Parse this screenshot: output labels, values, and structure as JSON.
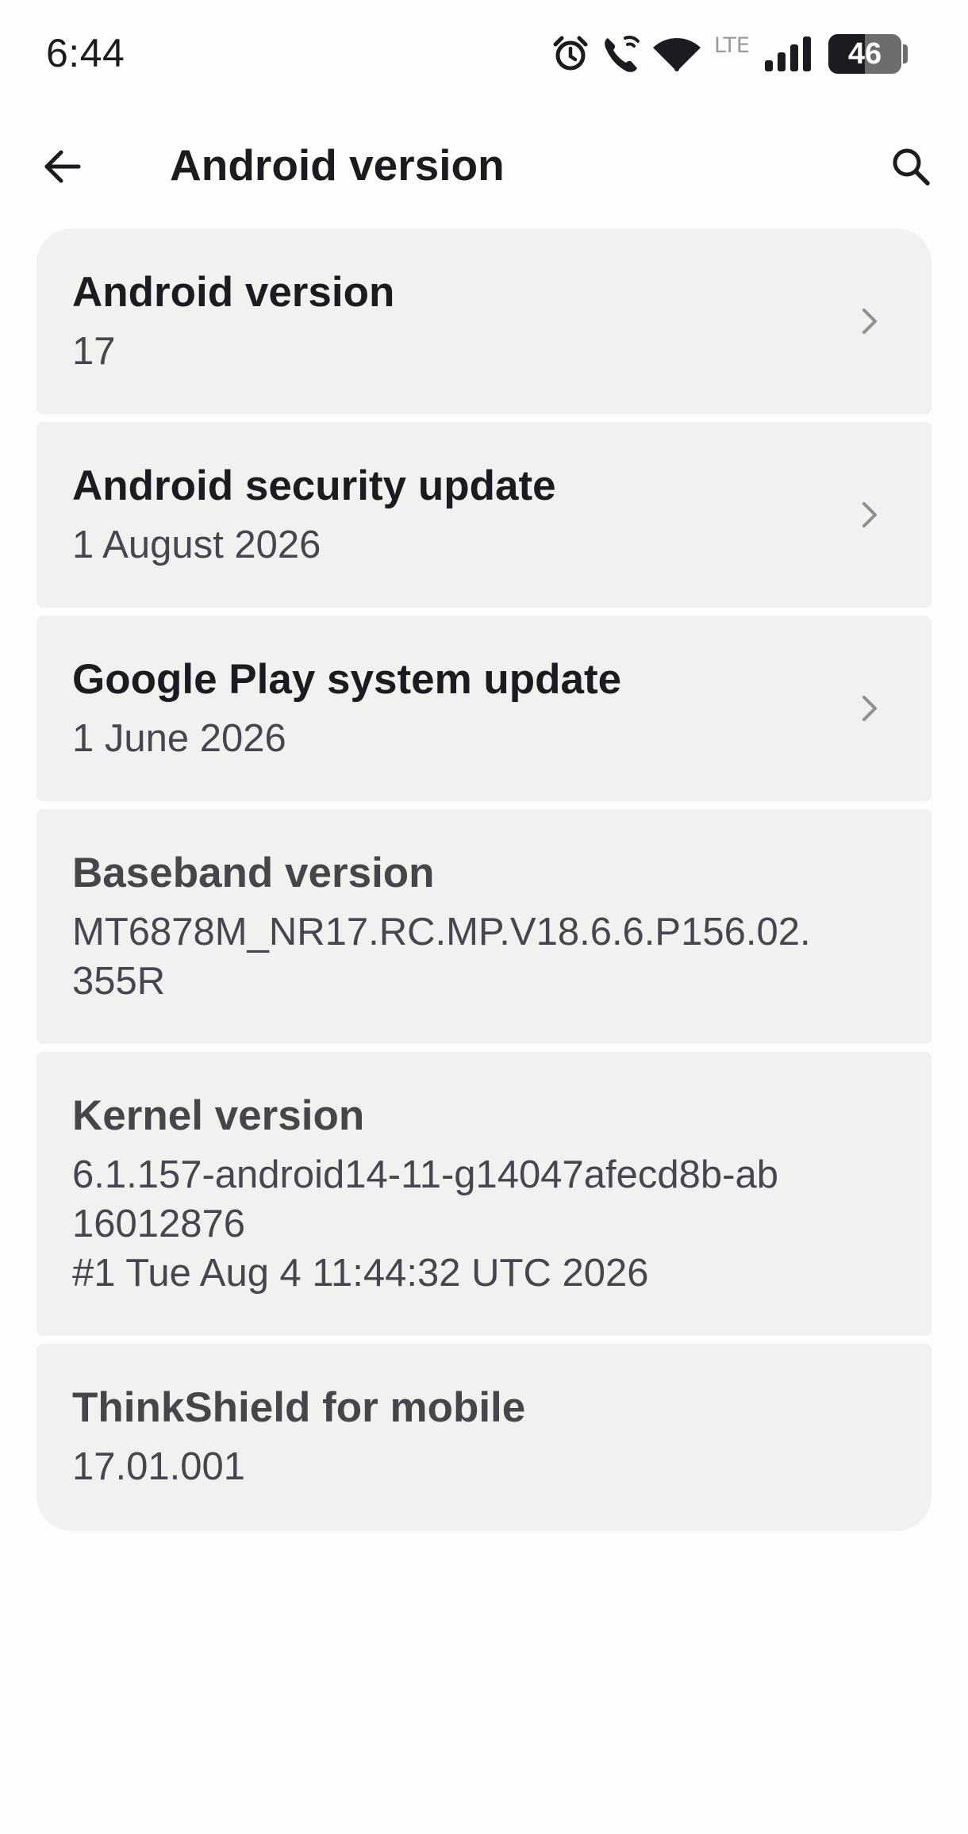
{
  "status_bar": {
    "time": "6:44",
    "network_label": "LTE",
    "battery_level": "46",
    "icons": [
      "alarm-icon",
      "wifi-calling-icon",
      "wifi-icon",
      "signal-icon",
      "battery-icon"
    ]
  },
  "header": {
    "title": "Android version",
    "back_icon": "arrow-back-icon",
    "search_icon": "search-icon"
  },
  "items": [
    {
      "title": "Android version",
      "value": "17",
      "has_chevron": true
    },
    {
      "title": "Android security update",
      "value": "1 August 2026",
      "has_chevron": true
    },
    {
      "title": "Google Play system update",
      "value": "1 June 2026",
      "has_chevron": true
    },
    {
      "title": "Baseband version",
      "value": "MT6878M_NR17.RC.MP.V18.6.6.P156.02.\n355R",
      "has_chevron": false
    },
    {
      "title": "Kernel version",
      "value": "6.1.157-android14-11-g14047afecd8b-ab\n16012876\n#1 Tue Aug  4 11:44:32 UTC 2026",
      "has_chevron": false
    },
    {
      "title": "ThinkShield for mobile",
      "value": "17.01.001",
      "has_chevron": false
    }
  ],
  "colors": {
    "background": "#fefdfd",
    "card": "#f2f1f0",
    "title_text": "#1c1b1f",
    "secondary_text": "#49454f",
    "chevron": "#8e8e93"
  }
}
